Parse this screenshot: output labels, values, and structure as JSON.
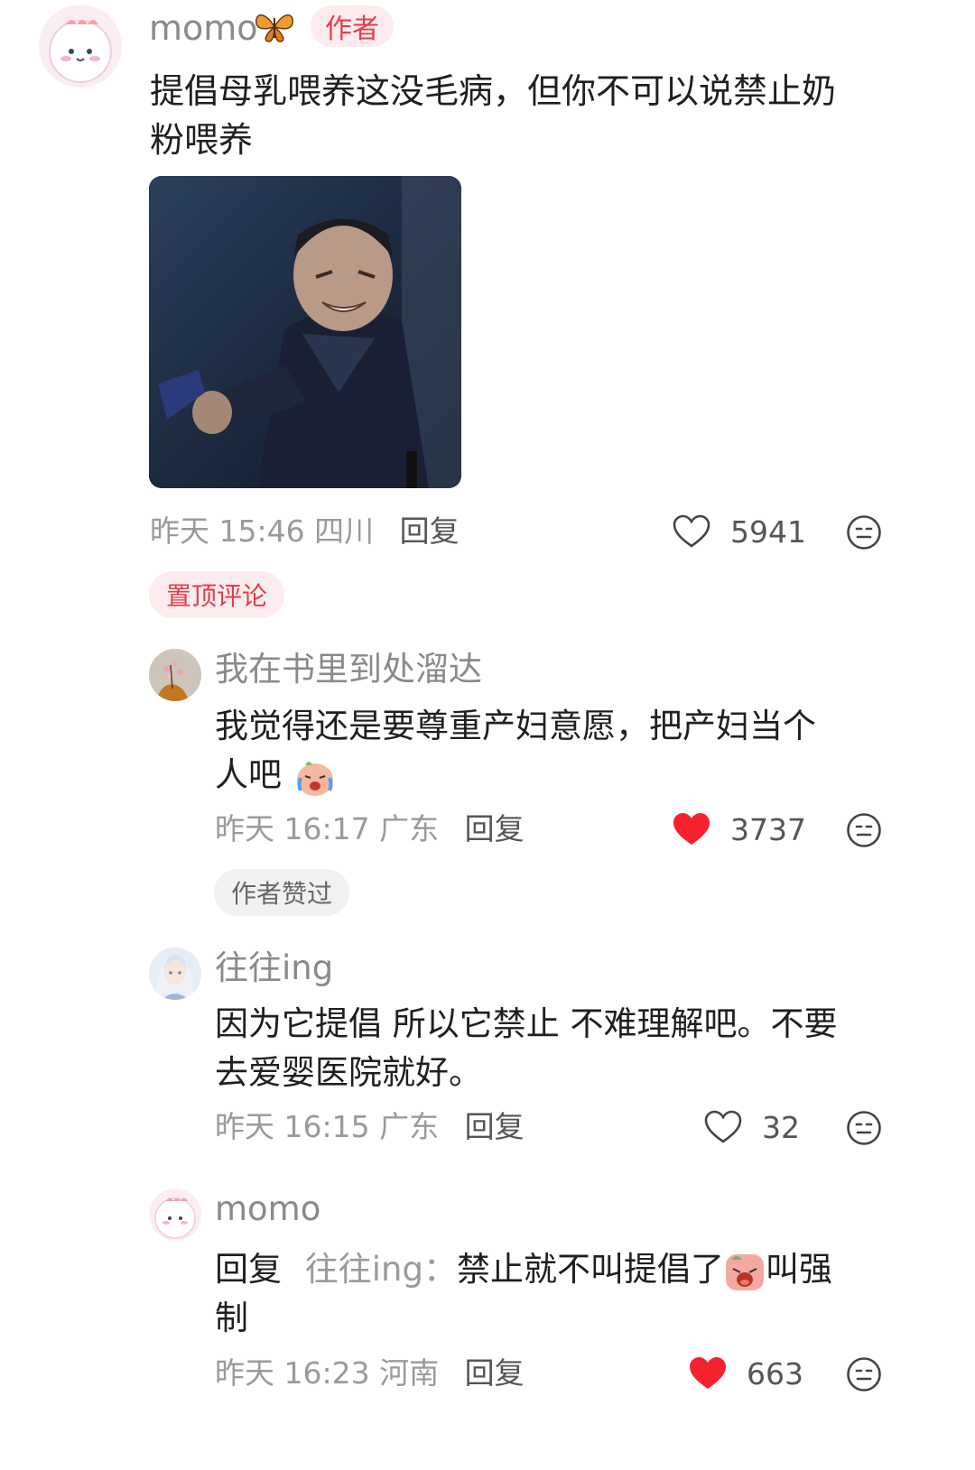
{
  "top_comment": {
    "username": "momo",
    "author_badge": "作者",
    "text_line1": "提倡母乳喂养这没毛病，但你不可以说禁止奶",
    "text_line2": "粉喂养",
    "time": "昨天 15:46",
    "location": "四川",
    "reply_label": "回复",
    "likes": "5941",
    "liked": false,
    "pinned_badge": "置顶评论"
  },
  "replies": [
    {
      "username": "我在书里到处溜达",
      "text_line1": "我觉得还是要尊重产妇意愿，把产妇当个",
      "text_line2": "人吧",
      "time": "昨天 16:17",
      "location": "广东",
      "reply_label": "回复",
      "likes": "3737",
      "liked": true,
      "badge": "作者赞过"
    },
    {
      "username": "往往ing",
      "text_line1": "因为它提倡 所以它禁止 不难理解吧。不要",
      "text_line2": "去爱婴医院就好。",
      "time": "昨天 16:15",
      "location": "广东",
      "reply_label": "回复",
      "likes": "32",
      "liked": false
    },
    {
      "username": "momo",
      "reply_prefix": "回复",
      "reply_to": "往往ing：",
      "text_part1": "禁止就不叫提倡了",
      "text_part2": "叫强",
      "text_line2": "制",
      "time": "昨天 16:23",
      "location": "河南",
      "reply_label": "回复",
      "likes": "663",
      "liked": true
    }
  ],
  "colors": {
    "like_red": "#f5222d",
    "badge_red_text": "#e63b4a",
    "badge_red_bg": "#fdecee",
    "muted": "#9a9a9a"
  },
  "icons": [
    "butterfly-icon",
    "heart-outline-icon",
    "heart-filled-icon",
    "emoji-face-icon",
    "crying-emoji",
    "wailing-emoji"
  ]
}
